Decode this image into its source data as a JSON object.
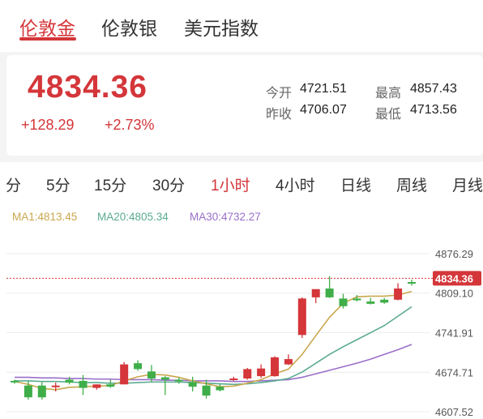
{
  "tabs": [
    "伦敦金",
    "伦敦银",
    "美元指数"
  ],
  "quote": {
    "price": "4834.36",
    "change": "+128.29",
    "change_pct": "+2.73%",
    "open_label": "今开",
    "open": "4721.51",
    "prev_close_label": "昨收",
    "prev_close": "4706.07",
    "high_label": "最高",
    "high": "4857.43",
    "low_label": "最低",
    "low": "4713.56"
  },
  "periods": [
    "分",
    "5分",
    "15分",
    "30分",
    "1小时",
    "4小时",
    "日线",
    "周线",
    "月线"
  ],
  "active_period": "1小时",
  "colors": {
    "up": "#d4363a",
    "down": "#3fae49",
    "ma1": "#c9a74d",
    "ma20": "#5aab8f",
    "ma30": "#9a6fc9"
  },
  "chart_data": {
    "type": "candlestick",
    "y_ticks": [
      "4876.29",
      "4809.10",
      "4741.91",
      "4674.71",
      "4607.52"
    ],
    "y_tick_values": [
      4876.29,
      4809.1,
      4741.91,
      4674.71,
      4607.52
    ],
    "ylim": [
      4607.52,
      4876.29
    ],
    "current_price_label": "4834.36",
    "current_price": 4834.36,
    "ma_legend": [
      {
        "label": "MA1:4813.45"
      },
      {
        "label": "MA20:4805.34"
      },
      {
        "label": "MA30:4732.27"
      }
    ],
    "candles": [
      {
        "o": 4660,
        "h": 4662,
        "l": 4655,
        "c": 4658
      },
      {
        "o": 4652,
        "h": 4660,
        "l": 4628,
        "c": 4632
      },
      {
        "o": 4652,
        "h": 4658,
        "l": 4628,
        "c": 4632
      },
      {
        "o": 4652,
        "h": 4657,
        "l": 4642,
        "c": 4652
      },
      {
        "o": 4662,
        "h": 4667,
        "l": 4654,
        "c": 4657
      },
      {
        "o": 4660,
        "h": 4670,
        "l": 4636,
        "c": 4648
      },
      {
        "o": 4648,
        "h": 4654,
        "l": 4645,
        "c": 4654
      },
      {
        "o": 4654,
        "h": 4662,
        "l": 4648,
        "c": 4650
      },
      {
        "o": 4654,
        "h": 4692,
        "l": 4654,
        "c": 4688
      },
      {
        "o": 4690,
        "h": 4695,
        "l": 4677,
        "c": 4680
      },
      {
        "o": 4676,
        "h": 4687,
        "l": 4658,
        "c": 4664
      },
      {
        "o": 4666,
        "h": 4668,
        "l": 4636,
        "c": 4662
      },
      {
        "o": 4662,
        "h": 4666,
        "l": 4655,
        "c": 4660
      },
      {
        "o": 4658,
        "h": 4667,
        "l": 4642,
        "c": 4650
      },
      {
        "o": 4652,
        "h": 4662,
        "l": 4630,
        "c": 4635
      },
      {
        "o": 4650,
        "h": 4655,
        "l": 4642,
        "c": 4644
      },
      {
        "o": 4662,
        "h": 4667,
        "l": 4660,
        "c": 4664
      },
      {
        "o": 4664,
        "h": 4682,
        "l": 4662,
        "c": 4680
      },
      {
        "o": 4668,
        "h": 4688,
        "l": 4665,
        "c": 4681
      },
      {
        "o": 4668,
        "h": 4702,
        "l": 4667,
        "c": 4700
      },
      {
        "o": 4688,
        "h": 4705,
        "l": 4687,
        "c": 4697
      },
      {
        "o": 4738,
        "h": 4802,
        "l": 4733,
        "c": 4800
      },
      {
        "o": 4802,
        "h": 4812,
        "l": 4792,
        "c": 4816
      },
      {
        "o": 4817,
        "h": 4838,
        "l": 4801,
        "c": 4802
      },
      {
        "o": 4800,
        "h": 4808,
        "l": 4783,
        "c": 4787
      },
      {
        "o": 4800,
        "h": 4806,
        "l": 4795,
        "c": 4797
      },
      {
        "o": 4795,
        "h": 4801,
        "l": 4790,
        "c": 4791
      },
      {
        "o": 4798,
        "h": 4801,
        "l": 4791,
        "c": 4793
      },
      {
        "o": 4798,
        "h": 4826,
        "l": 4797,
        "c": 4817
      },
      {
        "o": 4828,
        "h": 4832,
        "l": 4822,
        "c": 4826
      }
    ],
    "ma1": [
      4659,
      4654,
      4647,
      4645,
      4649,
      4650,
      4651,
      4652,
      4660,
      4667,
      4671,
      4670,
      4666,
      4660,
      4655,
      4650,
      4651,
      4656,
      4662,
      4672,
      4680,
      4705,
      4737,
      4768,
      4792,
      4803,
      4804,
      4804,
      4806,
      4812
    ],
    "ma20": [
      4660,
      4660,
      4659,
      4659,
      4658,
      4657,
      4657,
      4656,
      4656,
      4657,
      4658,
      4658,
      4658,
      4657,
      4656,
      4655,
      4654,
      4655,
      4657,
      4660,
      4664,
      4675,
      4690,
      4705,
      4718,
      4730,
      4742,
      4754,
      4770,
      4786
    ],
    "ma30": [
      4666,
      4666,
      4665,
      4665,
      4664,
      4664,
      4663,
      4663,
      4662,
      4662,
      4662,
      4661,
      4661,
      4660,
      4660,
      4660,
      4659,
      4659,
      4660,
      4661,
      4662,
      4666,
      4672,
      4678,
      4684,
      4690,
      4697,
      4705,
      4713,
      4722
    ]
  }
}
